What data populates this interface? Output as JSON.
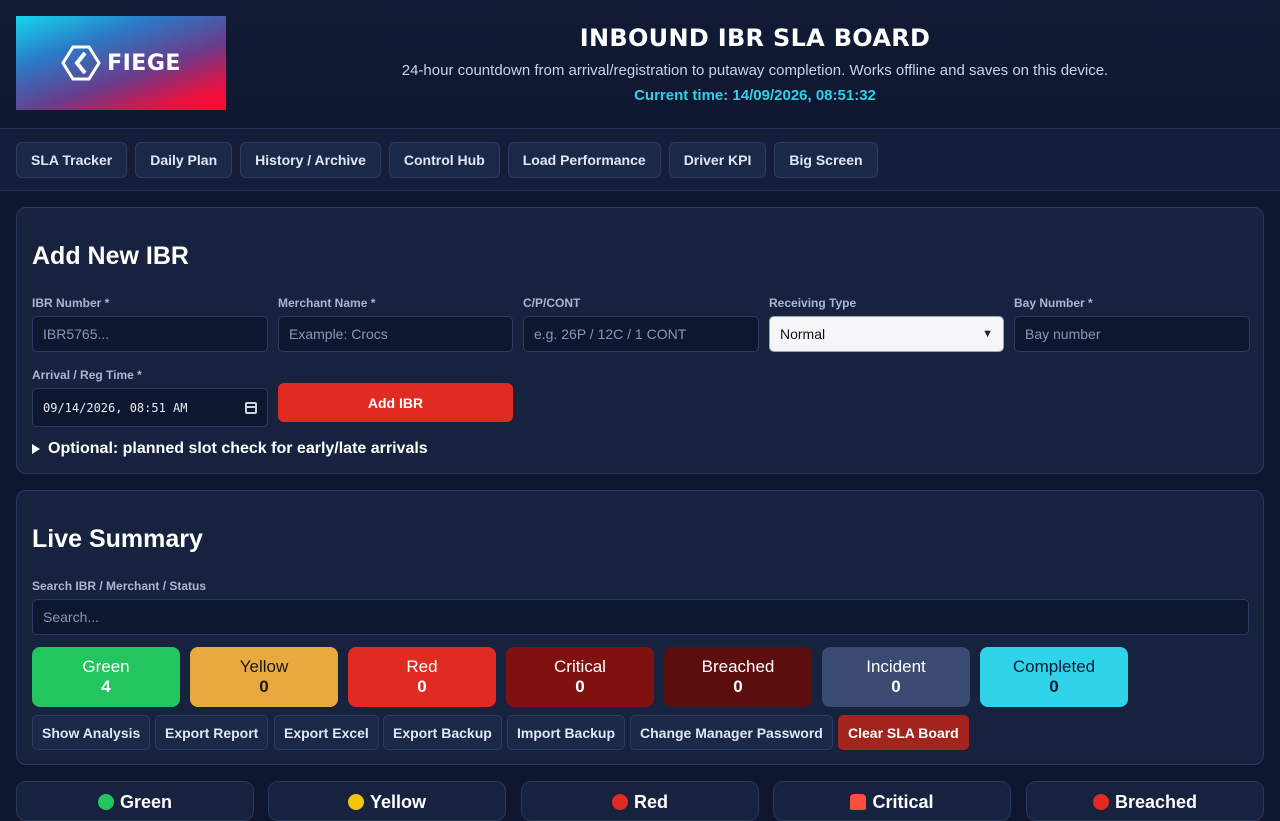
{
  "header": {
    "logo_text": "FIEGE",
    "title": "INBOUND IBR SLA BOARD",
    "subtitle": "24-hour countdown from arrival/registration to putaway completion. Works offline and saves on this device.",
    "current_time": "Current time: 14/09/2026, 08:51:32"
  },
  "nav": {
    "items": [
      "SLA Tracker",
      "Daily Plan",
      "History / Archive",
      "Control Hub",
      "Load Performance",
      "Driver KPI",
      "Big Screen"
    ]
  },
  "add_form": {
    "title": "Add New IBR",
    "ibr_label": "IBR Number *",
    "ibr_placeholder": "IBR5765...",
    "merchant_label": "Merchant Name *",
    "merchant_placeholder": "Example: Crocs",
    "cpcont_label": "C/P/CONT",
    "cpcont_placeholder": "e.g. 26P / 12C / 1 CONT",
    "receiving_label": "Receiving Type",
    "receiving_value": "Normal",
    "bay_label": "Bay Number *",
    "bay_placeholder": "Bay number",
    "arrival_label": "Arrival / Reg Time *",
    "arrival_value": "09/14/2026, 08:51 AM",
    "add_button": "Add IBR",
    "optional_toggle": "Optional: planned slot check for early/late arrivals"
  },
  "summary": {
    "title": "Live Summary",
    "search_label": "Search IBR / Merchant / Status",
    "search_placeholder": "Search...",
    "stats": [
      {
        "label": "Green",
        "value": "4",
        "bg": "#22c55e",
        "fg": "#ffffff"
      },
      {
        "label": "Yellow",
        "value": "0",
        "bg": "#e8a93e",
        "fg": "#1a1a1a"
      },
      {
        "label": "Red",
        "value": "0",
        "bg": "#e02a22",
        "fg": "#ffffff"
      },
      {
        "label": "Critical",
        "value": "0",
        "bg": "#7f1111",
        "fg": "#ffffff"
      },
      {
        "label": "Breached",
        "value": "0",
        "bg": "#5c0d0d",
        "fg": "#ffffff"
      },
      {
        "label": "Incident",
        "value": "0",
        "bg": "#3b4a70",
        "fg": "#ffffff"
      },
      {
        "label": "Completed",
        "value": "0",
        "bg": "#2fd3ea",
        "fg": "#0d1a33"
      }
    ],
    "actions": [
      "Show Analysis",
      "Export Report",
      "Export Excel",
      "Export Backup",
      "Import Backup",
      "Change Manager Password",
      "Clear SLA Board"
    ]
  },
  "lanes": [
    {
      "label": "Green",
      "color": "#22c55e"
    },
    {
      "label": "Yellow",
      "color": "#f1c40f"
    },
    {
      "label": "Red",
      "color": "#e02a22"
    },
    {
      "label": "Critical",
      "color": "#ff4d3d"
    },
    {
      "label": "Breached",
      "color": "#e02a22"
    }
  ]
}
